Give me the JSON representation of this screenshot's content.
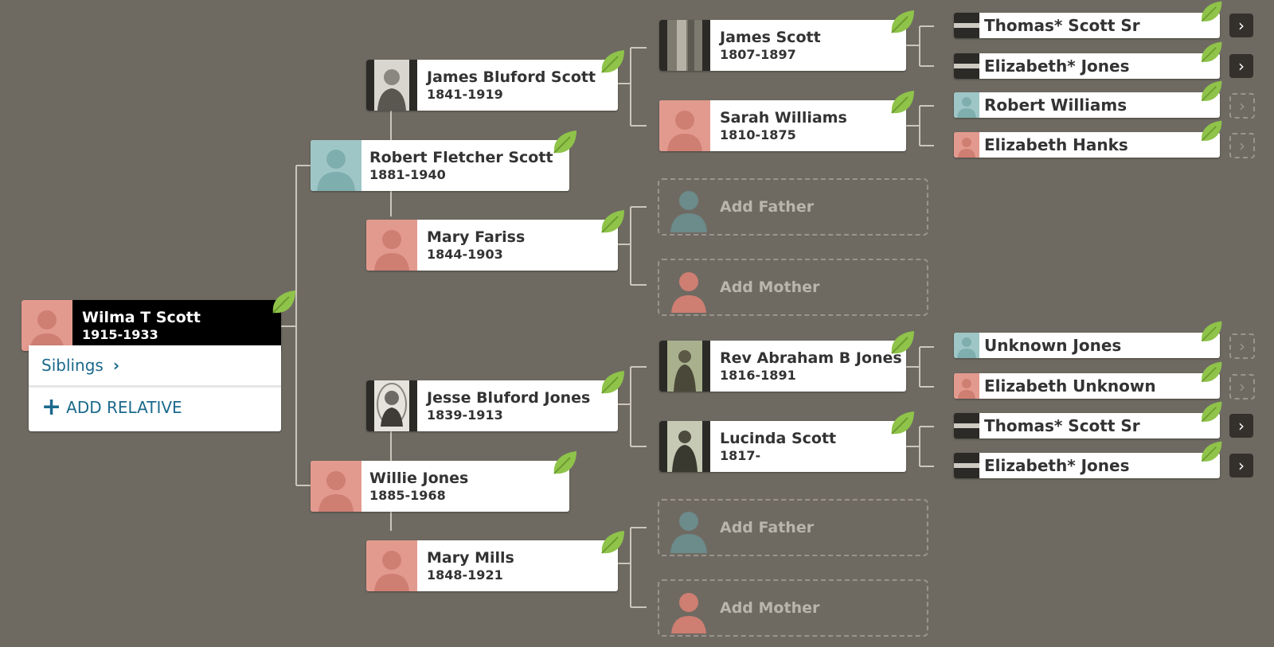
{
  "focus": {
    "name": "Wilma T Scott",
    "dates": "1915-1933"
  },
  "panel": {
    "siblings_label": "Siblings",
    "add_relative_label": "ADD RELATIVE"
  },
  "parents": {
    "father": {
      "name": "Robert Fletcher Scott",
      "dates": "1881-1940"
    },
    "mother": {
      "name": "Willie Jones",
      "dates": "1885-1968"
    }
  },
  "grandparents": {
    "paternal_father": {
      "name": "James Bluford Scott",
      "dates": "1841-1919"
    },
    "paternal_mother": {
      "name": "Mary Fariss",
      "dates": "1844-1903"
    },
    "maternal_father": {
      "name": "Jesse Bluford Jones",
      "dates": "1839-1913"
    },
    "maternal_mother": {
      "name": "Mary Mills",
      "dates": "1848-1921"
    }
  },
  "great_grandparents": {
    "g1": {
      "name": "James Scott",
      "dates": "1807-1897"
    },
    "g2": {
      "name": "Sarah Williams",
      "dates": "1810-1875"
    },
    "g5": {
      "name": "Rev Abraham B Jones",
      "dates": "1816-1891"
    },
    "g6": {
      "name": "Lucinda Scott",
      "dates": "1817-"
    }
  },
  "add_labels": {
    "father": "Add Father",
    "mother": "Add Mother"
  },
  "gen5": [
    {
      "name": "Thomas* Scott Sr",
      "photo": "hist",
      "more": "solid"
    },
    {
      "name": "Elizabeth* Jones",
      "photo": "hist",
      "more": "solid"
    },
    {
      "name": "Robert Williams",
      "photo": "male",
      "more": "dashed"
    },
    {
      "name": "Elizabeth Hanks",
      "photo": "female",
      "more": "dashed"
    },
    {
      "name": "Unknown Jones",
      "photo": "male",
      "more": "dashed"
    },
    {
      "name": "Elizabeth Unknown",
      "photo": "female",
      "more": "dashed"
    },
    {
      "name": "Thomas* Scott Sr",
      "photo": "hist",
      "more": "solid"
    },
    {
      "name": "Elizabeth* Jones",
      "photo": "hist",
      "more": "solid"
    }
  ],
  "icons": {
    "leaf": "leaf-icon",
    "more": "chevron-right-icon",
    "plus": "plus-icon",
    "female": "female-silhouette-icon",
    "male": "male-silhouette-icon"
  },
  "colors": {
    "background": "#6e6a62",
    "female": "#e39a8e",
    "male": "#9fc6c6",
    "link": "#1b6a8c",
    "leaf": "#8fc34a"
  }
}
